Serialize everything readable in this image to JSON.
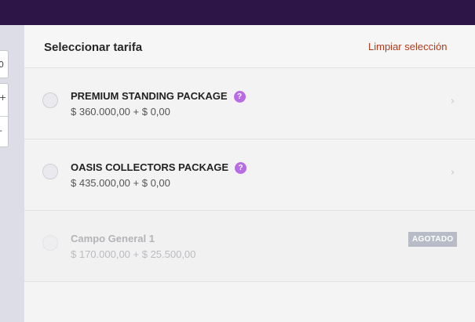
{
  "panel": {
    "title": "Seleccionar tarifa",
    "clear_label": "Limpiar selección"
  },
  "side_controls": [
    "0",
    "+",
    "-"
  ],
  "tariffs": [
    {
      "name": "PREMIUM STANDING PACKAGE",
      "help": "?",
      "price": "$ 360.000,00 + $ 0,00",
      "status": "available"
    },
    {
      "name": "OASIS COLLECTORS PACKAGE",
      "help": "?",
      "price": "$ 435.000,00 + $ 0,00",
      "status": "available"
    },
    {
      "name": "Campo General 1",
      "price": "$ 170.000,00 + $ 25.500,00",
      "status": "sold_out",
      "badge": "AGOTADO"
    }
  ],
  "icons": {
    "row_arrow": "chevron-right-icon",
    "help": "question-icon",
    "select": "radio-icon"
  },
  "colors": {
    "topbar": "#2d1547",
    "accent_link": "#b03a1c",
    "help_badge": "#b96be6",
    "sold_out_badge": "#b7bcc6"
  }
}
